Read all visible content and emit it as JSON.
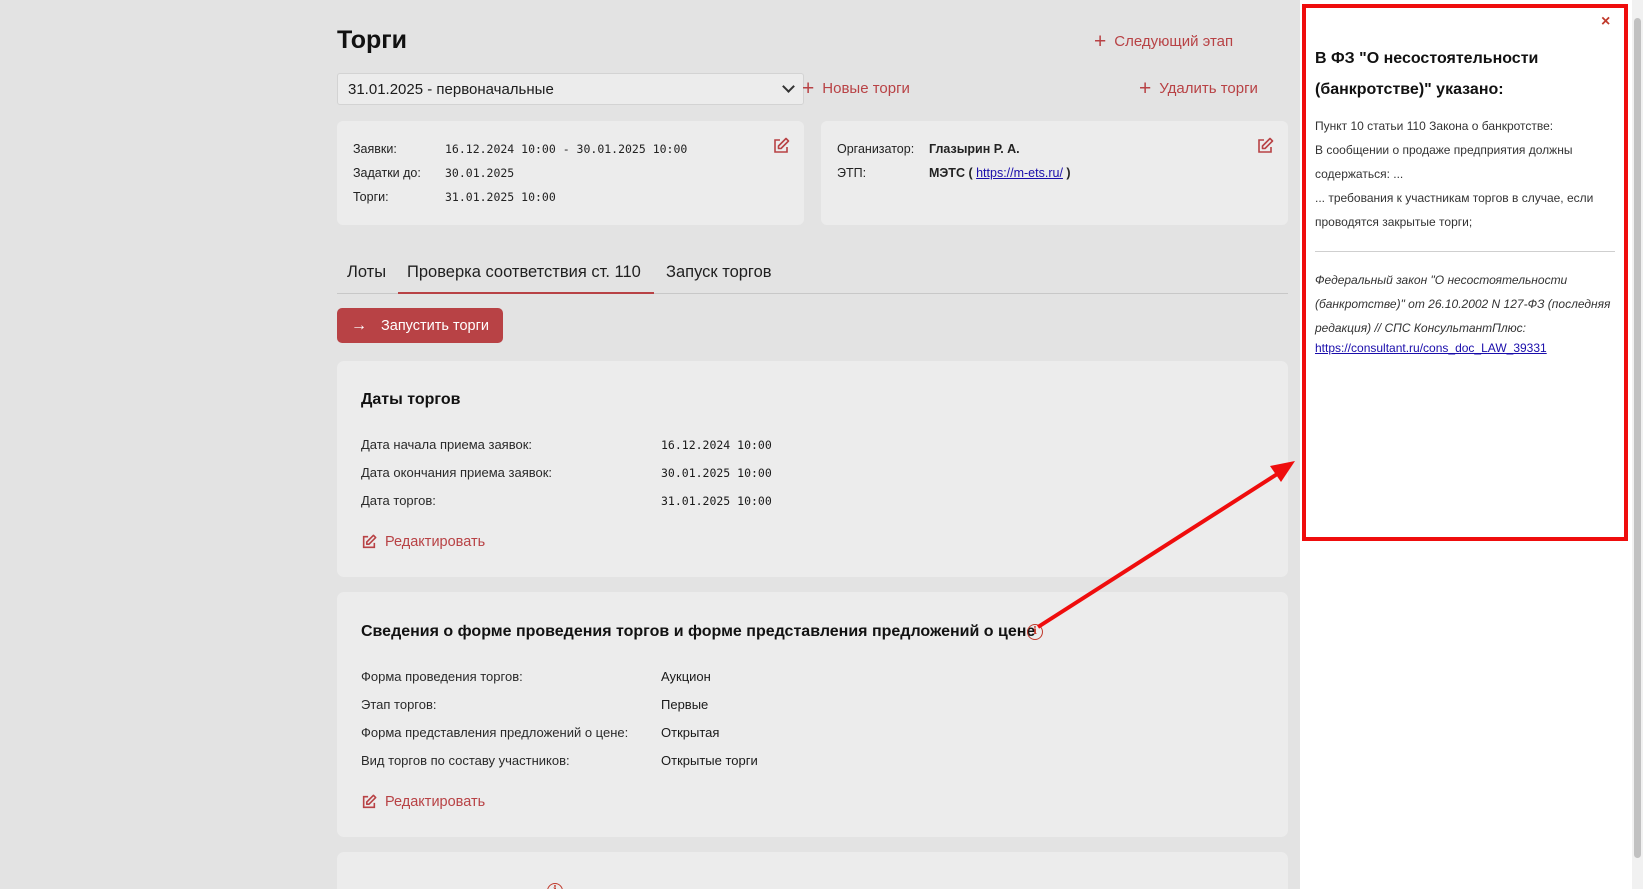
{
  "page": {
    "title": "Торги",
    "next_stage": "Следующий этап",
    "auction_select": "31.01.2025 - первоначальные",
    "new_auction": "Новые торги",
    "delete_auction": "Удалить торги"
  },
  "dates_card": {
    "rows": [
      {
        "label": "Заявки:",
        "value": "16.12.2024 10:00 - 30.01.2025 10:00"
      },
      {
        "label": "Задатки до:",
        "value": "30.01.2025"
      },
      {
        "label": "Торги:",
        "value": "31.01.2025 10:00"
      }
    ]
  },
  "org_card": {
    "organizer_label": "Организатор:",
    "organizer_value": "Глазырин Р. А.",
    "etp_label": "ЭТП:",
    "etp_prefix": "МЭТС (",
    "etp_link": "https://m-ets.ru/",
    "etp_suffix": ")"
  },
  "tabs": [
    {
      "label": "Лоты"
    },
    {
      "label": "Проверка соответствия ст. 110"
    },
    {
      "label": "Запуск торгов"
    }
  ],
  "start_button": "Запустить торги",
  "section_dates": {
    "title": "Даты торгов",
    "rows": [
      {
        "label": "Дата начала приема заявок:",
        "value": "16.12.2024 10:00"
      },
      {
        "label": "Дата окончания приема заявок:",
        "value": "30.01.2025 10:00"
      },
      {
        "label": "Дата торгов:",
        "value": "31.01.2025 10:00"
      }
    ],
    "edit": "Редактировать"
  },
  "section_form": {
    "title": "Сведения о форме проведения торгов и форме представления предложений о цене",
    "rows": [
      {
        "label": "Форма проведения торгов:",
        "value": "Аукцион"
      },
      {
        "label": "Этап торгов:",
        "value": "Первые"
      },
      {
        "label": "Форма представления предложений о цене:",
        "value": "Открытая"
      },
      {
        "label": "Вид торгов по составу участников:",
        "value": "Открытые торги"
      }
    ],
    "edit": "Редактировать"
  },
  "panel": {
    "close": "×",
    "title": "В ФЗ \"О несостоятельности (банкротстве)\" указано:",
    "paragraphs": [
      "Пункт 10 статьи 110 Закона о банкротстве:",
      "В сообщении о продаже предприятия должны содержаться: ...",
      "... требования к участникам торгов в случае, если проводятся закрытые торги;"
    ],
    "citation": "Федеральный закон \"О несостоятельности (банкротстве)\" от 26.10.2002 N 127-ФЗ (последняя редакция) // СПС КонсультантПлюс:",
    "link": "https://consultant.ru/cons_doc_LAW_39331"
  },
  "colors": {
    "accent": "#b84245",
    "annotation": "#ef0d0d",
    "background": "#e3e3e3",
    "card": "#ececec"
  }
}
